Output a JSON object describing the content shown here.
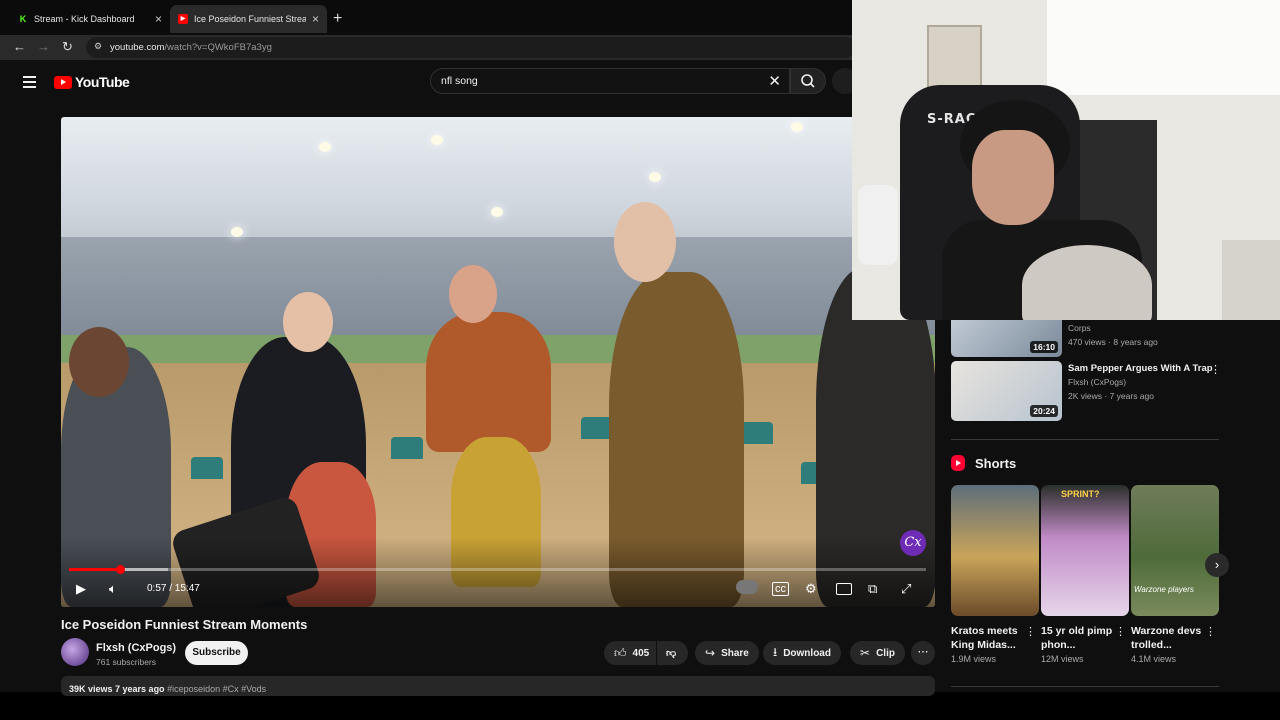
{
  "browser": {
    "tabs": [
      {
        "title": "Stream - Kick Dashboard",
        "icon": "kick-icon",
        "active": false
      },
      {
        "title": "Ice Poseidon Funniest Stream M",
        "icon": "youtube-icon",
        "active": true
      }
    ],
    "url_host": "youtube.com",
    "url_path": "/watch?v=QWkoFB7a3yg"
  },
  "youtube": {
    "logo_text": "YouTube",
    "search_value": "nfl song",
    "video": {
      "title": "Ice Poseidon Funniest Stream Moments",
      "time_display": "0:57 / 15:47",
      "progress_fraction": 0.06,
      "buffered_fraction": 0.115,
      "watermark": "Cx"
    },
    "channel": {
      "name": "Flxsh (CxPogs)",
      "subscribers": "761 subscribers",
      "subscribe_label": "Subscribe"
    },
    "actions": {
      "likes": "405",
      "share": "Share",
      "download": "Download",
      "clip": "Clip"
    },
    "description": {
      "stats": "39K views  7 years ago",
      "tags": "#iceposeidon #Cx #Vods"
    },
    "sidebar": {
      "recommendations": [
        {
          "title": "",
          "channel": "Corps",
          "meta": "470 views · 8 years ago",
          "duration": "16:10"
        },
        {
          "title": "Sam Pepper Argues With A Trap",
          "channel": "Flxsh (CxPogs)",
          "meta": "2K views · 7 years ago",
          "duration": "20:24"
        }
      ],
      "shorts_heading": "Shorts",
      "shorts": [
        {
          "title": "Kratos meets King Midas...",
          "views": "1.9M views",
          "overlay": ""
        },
        {
          "title": "15 yr old pimp phon...",
          "views": "12M views",
          "overlay": "SPRINT?"
        },
        {
          "title": "Warzone devs trolled...",
          "views": "4.1M views",
          "overlay": "Warzone players"
        }
      ]
    }
  },
  "webcam": {
    "chair_brand": "S-RAC"
  },
  "colors": {
    "brand_red": "#ff0000",
    "background": "#0f0f0f",
    "pill": "#272727"
  }
}
